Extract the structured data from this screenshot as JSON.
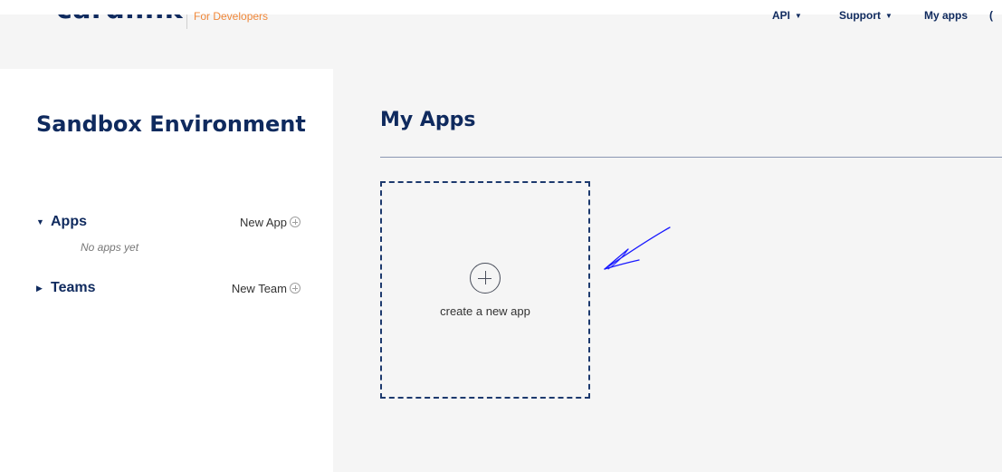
{
  "header": {
    "logo_text": "cardlink",
    "tagline": "For Developers",
    "nav": [
      {
        "label": "API"
      },
      {
        "label": "Support"
      },
      {
        "label": "My apps"
      }
    ],
    "nav_cutoff": "("
  },
  "sidebar": {
    "title": "Sandbox Environment",
    "sections": {
      "apps": {
        "label": "Apps",
        "new_label": "New App",
        "empty_text": "No apps yet"
      },
      "teams": {
        "label": "Teams",
        "new_label": "New Team"
      }
    }
  },
  "main": {
    "title": "My Apps",
    "create_card_label": "create a new app"
  },
  "icons": {
    "apps_toggle": "caret-down-icon",
    "teams_toggle": "caret-right-icon",
    "add": "plus-circle-icon",
    "annotation": "hand-drawn-arrow-icon"
  },
  "colors": {
    "brand_navy": "#0f2a5e",
    "tagline_orange": "#f0883a",
    "page_background": "#f5f5f5",
    "annotation_blue": "#1a1aff"
  }
}
